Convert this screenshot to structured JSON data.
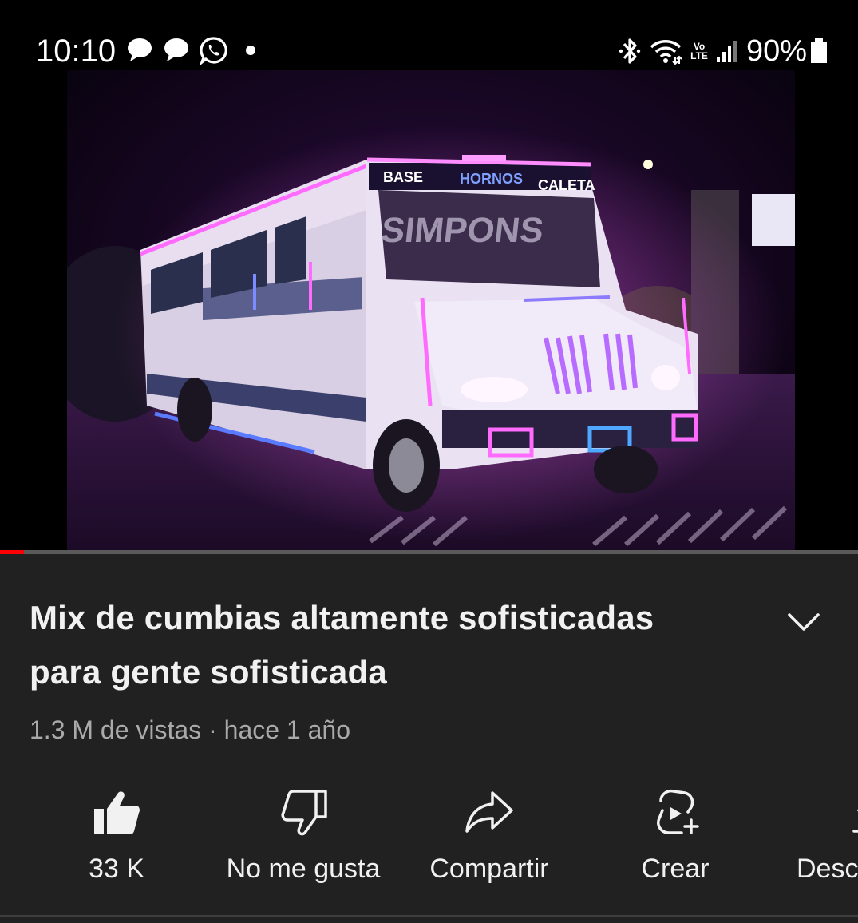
{
  "status_bar": {
    "time": "10:10",
    "left_icons": [
      "chat-bubble-icon",
      "chat-bubble-icon",
      "whatsapp-icon",
      "dot-icon"
    ],
    "right_icons": [
      "bluetooth-icon",
      "wifi-icon",
      "volte-icon",
      "signal-icon"
    ],
    "volte_top": "Vo",
    "volte_bottom": "LTE",
    "battery_percent": "90%",
    "battery_level": 0.9
  },
  "video": {
    "thumbnail_signs": {
      "left": "BASE",
      "center": "HORNOS",
      "right": "CALETA"
    },
    "progress_fraction": 0.028,
    "progress_color": "#ff0000"
  },
  "info": {
    "title_line1": "Mix de cumbias altamente sofisticadas",
    "title_line2": "para gente sofisticada",
    "meta": "1.3 M de vistas · hace 1 año"
  },
  "actions": [
    {
      "icon": "thumbs-up-icon",
      "label": "33 K"
    },
    {
      "icon": "thumbs-down-icon",
      "label": "No me gusta"
    },
    {
      "icon": "share-icon",
      "label": "Compartir"
    },
    {
      "icon": "create-icon",
      "label": "Crear"
    },
    {
      "icon": "download-icon",
      "label": "Desc"
    }
  ],
  "colors": {
    "background": "#212121",
    "status_bar": "#000000",
    "text_primary": "#f1f1f1",
    "text_secondary": "#aaaaaa",
    "neon_pink": "#ff4dff",
    "neon_blue": "#6a7bff"
  }
}
